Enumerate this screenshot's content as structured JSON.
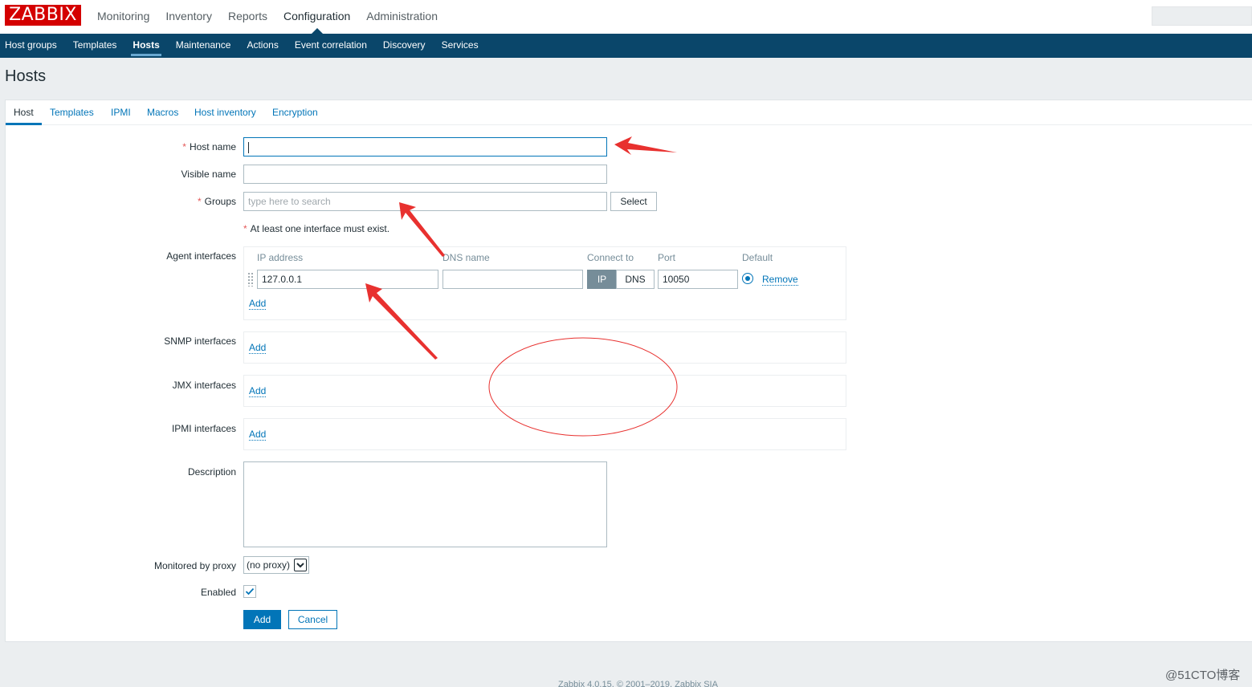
{
  "brand": {
    "logo_text": "ZABBIX",
    "logo_color": "#d40000"
  },
  "main_nav": [
    {
      "label": "Monitoring"
    },
    {
      "label": "Inventory"
    },
    {
      "label": "Reports"
    },
    {
      "label": "Configuration",
      "active": true
    },
    {
      "label": "Administration"
    }
  ],
  "sub_nav": [
    {
      "label": "Host groups"
    },
    {
      "label": "Templates"
    },
    {
      "label": "Hosts",
      "active": true
    },
    {
      "label": "Maintenance"
    },
    {
      "label": "Actions"
    },
    {
      "label": "Event correlation"
    },
    {
      "label": "Discovery"
    },
    {
      "label": "Services"
    }
  ],
  "page_title": "Hosts",
  "tabs": [
    {
      "label": "Host",
      "active": true
    },
    {
      "label": "Templates"
    },
    {
      "label": "IPMI"
    },
    {
      "label": "Macros"
    },
    {
      "label": "Host inventory"
    },
    {
      "label": "Encryption"
    }
  ],
  "form": {
    "host_name": {
      "label": "Host name",
      "value": "",
      "required": true
    },
    "visible_name": {
      "label": "Visible name",
      "value": ""
    },
    "groups": {
      "label": "Groups",
      "placeholder": "type here to search",
      "select_label": "Select",
      "required": true
    },
    "interface_note": "At least one interface must exist.",
    "required_mark": "*",
    "agent_interfaces": {
      "label": "Agent interfaces",
      "columns": {
        "ip": "IP address",
        "dns": "DNS name",
        "connect": "Connect to",
        "port": "Port",
        "default": "Default"
      },
      "row": {
        "ip": "127.0.0.1",
        "dns": "",
        "connect_ip": "IP",
        "connect_dns": "DNS",
        "port": "10050",
        "remove": "Remove"
      },
      "add": "Add"
    },
    "snmp_interfaces": {
      "label": "SNMP interfaces",
      "add": "Add"
    },
    "jmx_interfaces": {
      "label": "JMX interfaces",
      "add": "Add"
    },
    "ipmi_interfaces": {
      "label": "IPMI interfaces",
      "add": "Add"
    },
    "description": {
      "label": "Description",
      "value": ""
    },
    "proxy": {
      "label": "Monitored by proxy",
      "selected": "(no proxy)"
    },
    "enabled": {
      "label": "Enabled",
      "checked": true
    },
    "buttons": {
      "add": "Add",
      "cancel": "Cancel"
    }
  },
  "footer": "Zabbix 4.0.15. © 2001–2019, Zabbix SIA",
  "watermark": "@51CTO博客",
  "colors": {
    "accent": "#0275b8",
    "subnav_bg": "#0a466a",
    "annotation_red": "#e8312f"
  }
}
